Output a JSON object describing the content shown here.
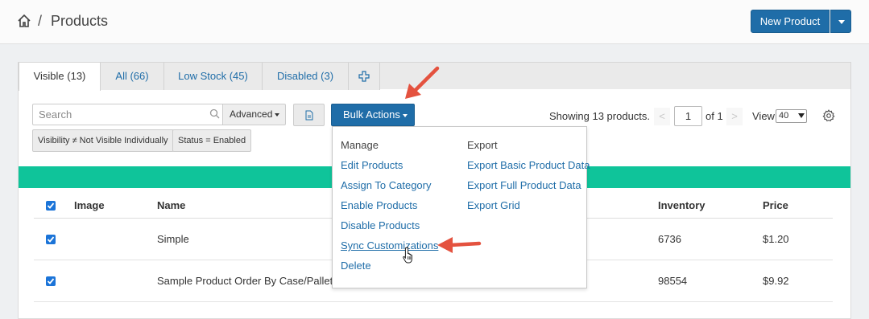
{
  "header": {
    "breadcrumb_sep": "/",
    "title": "Products",
    "new_product_label": "New Product"
  },
  "tabs": [
    {
      "label": "Visible (13)",
      "active": true
    },
    {
      "label": "All (66)",
      "active": false
    },
    {
      "label": "Low Stock (45)",
      "active": false
    },
    {
      "label": "Disabled (3)",
      "active": false
    }
  ],
  "toolbar": {
    "search_placeholder": "Search",
    "advanced_label": "Advanced",
    "bulk_actions_label": "Bulk Actions"
  },
  "filters": [
    "Visibility ≠ Not Visible Individually",
    "Status = Enabled"
  ],
  "pagination": {
    "showing_text": "Showing 13 products.",
    "prev_symbol": "<",
    "next_symbol": ">",
    "page": "1",
    "of_text": "of 1",
    "view_label": "View",
    "view_value": "40"
  },
  "table": {
    "headers": {
      "image": "Image",
      "name": "Name",
      "inventory": "Inventory",
      "price": "Price"
    },
    "rows": [
      {
        "name": "Simple",
        "inventory": "6736",
        "price": "$1.20"
      },
      {
        "name": "Sample Product Order By Case/Pallet",
        "inventory": "98554",
        "price": "$9.92"
      }
    ]
  },
  "bulk_menu": {
    "manage_heading": "Manage",
    "export_heading": "Export",
    "manage_items": [
      "Edit Products",
      "Assign To Category",
      "Enable Products",
      "Disable Products",
      "Sync Customizations",
      "Delete"
    ],
    "export_items": [
      "Export Basic Product Data",
      "Export Full Product Data",
      "Export Grid"
    ]
  },
  "colors": {
    "primary": "#1f6da8",
    "accent_bar": "#0fc49a",
    "annotation_arrow": "#e4523f",
    "checkbox": "#1b74d8"
  }
}
